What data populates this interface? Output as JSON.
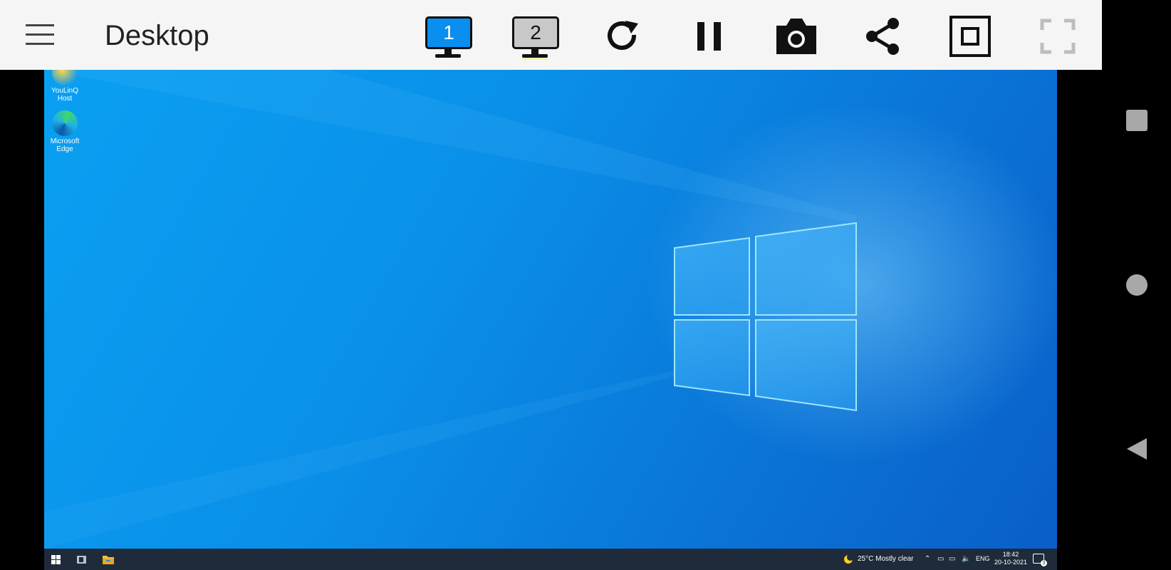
{
  "toolbar": {
    "title": "Desktop",
    "monitor1_label": "1",
    "monitor2_label": "2",
    "icons": [
      "menu-icon",
      "monitor-1-icon",
      "monitor-2-icon",
      "refresh-icon",
      "pause-icon",
      "camera-icon",
      "share-icon",
      "stop-icon",
      "fullscreen-icon"
    ]
  },
  "desktop": {
    "icons": [
      {
        "label": "YouLinQ Host"
      },
      {
        "label": "Microsoft Edge"
      }
    ]
  },
  "taskbar": {
    "weather": "25°C  Mostly clear",
    "language": "ENG",
    "time": "18:42",
    "date": "20-10-2021",
    "notifications": "3"
  },
  "colors": {
    "toolbar_bg": "#f5f5f5",
    "desktop_blue": "#0a8fe8",
    "taskbar_bg": "#1f2b3a"
  }
}
